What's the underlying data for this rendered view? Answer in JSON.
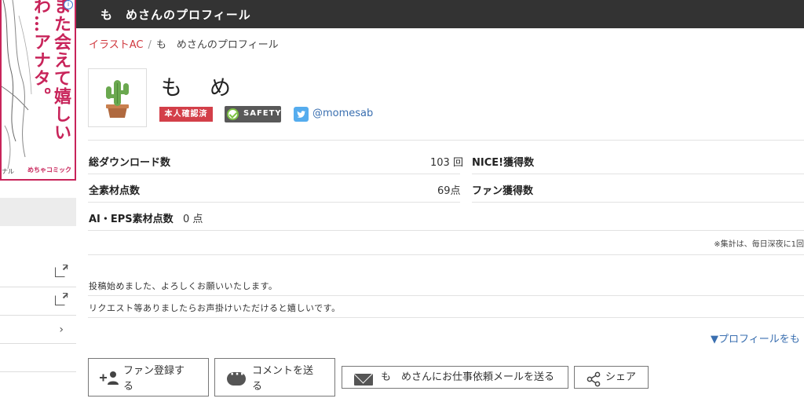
{
  "ad": {
    "text": "また会えて嬉しいわ…アナタ。",
    "logo": "めちゃコミック",
    "fragment": "ナル",
    "info_glyph": "i"
  },
  "sidebar": {
    "rows": [
      {
        "icon": "external-link-icon"
      },
      {
        "icon": "external-link-icon"
      },
      {
        "icon": "chevron-right-icon",
        "glyph": "›"
      },
      {
        "icon": ""
      }
    ]
  },
  "header": {
    "title": "も　めさんのプロフィール"
  },
  "breadcrumb": {
    "home": "イラストAC",
    "separator": "/",
    "current": "も　めさんのプロフィール"
  },
  "profile": {
    "name": "も　め",
    "badge_verified": "本人確認済",
    "badge_safety": "SAFETY",
    "twitter_handle": "@momesab"
  },
  "stats": {
    "downloads_label": "総ダウンロード数",
    "downloads_value": "103 回",
    "materials_label": "全素材点数",
    "materials_value": "69点",
    "ai_eps_label": "AI・EPS素材点数",
    "ai_eps_value": "0 点",
    "nice_label": "NICE!獲得数",
    "fans_label": "ファン獲得数",
    "note": "※集計は、毎日深夜に1回"
  },
  "intro": {
    "line1": "投稿始めました、よろしくお願いいたします。",
    "line2": "リクエスト等ありましたらお声掛けいただけると嬉しいです。",
    "more": "▼プロフィールをも"
  },
  "actions": {
    "fan_line1": "ファン登録す",
    "fan_line2": "る",
    "comment_line1": "コメントを送",
    "comment_line2": "る",
    "mail": "も　めさんにお仕事依頼メールを送る",
    "share": "シェア"
  },
  "colors": {
    "header_bg": "#333333",
    "accent_red": "#d0373d",
    "link_blue": "#3a6fb0",
    "twitter_blue": "#55acee",
    "safety_green": "#7cc242"
  }
}
